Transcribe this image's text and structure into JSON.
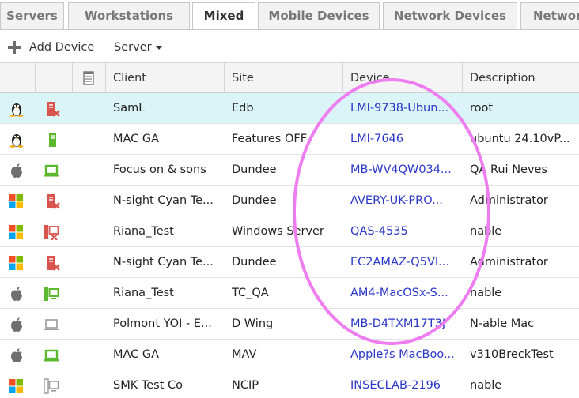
{
  "tabs": [
    {
      "label": "Servers",
      "active": false
    },
    {
      "label": "Workstations",
      "active": false
    },
    {
      "label": "Mixed",
      "active": true
    },
    {
      "label": "Mobile Devices",
      "active": false
    },
    {
      "label": "Network Devices",
      "active": false
    },
    {
      "label": "Networ",
      "active": false
    }
  ],
  "toolbar": {
    "add_device_label": "Add Device",
    "server_menu_label": "Server"
  },
  "columns": {
    "os": "",
    "status": "",
    "notes_icon": "notes-icon",
    "client": "Client",
    "site": "Site",
    "device": "Device",
    "description": "Description"
  },
  "rows": [
    {
      "os": "linux",
      "status": "server-red-x",
      "client": "SamL",
      "site": "Edb",
      "device": "LMI-9738-Ubun...",
      "description": "root",
      "selected": true
    },
    {
      "os": "linux",
      "status": "server-green",
      "client": "MAC GA",
      "site": "Features OFF",
      "device": "LMI-7646",
      "description": "ubuntu 24.10vP...",
      "selected": false
    },
    {
      "os": "apple",
      "status": "laptop-green",
      "client": "Focus on & sons",
      "site": "Dundee",
      "device": "MB-WV4QW034...",
      "description": "QA Rui Neves",
      "selected": false
    },
    {
      "os": "windows",
      "status": "server-red-x",
      "client": "N-sight Cyan Te...",
      "site": "Dundee",
      "device": "AVERY-UK-PRO...",
      "description": "Administrator",
      "selected": false
    },
    {
      "os": "windows",
      "status": "workstation-red-x",
      "client": "Riana_Test",
      "site": "Windows Server",
      "device": "QAS-4535",
      "description": "nable",
      "selected": false
    },
    {
      "os": "windows",
      "status": "server-red-x",
      "client": "N-sight Cyan Te...",
      "site": "Dundee",
      "device": "EC2AMAZ-Q5VI...",
      "description": "Administrator",
      "selected": false
    },
    {
      "os": "apple",
      "status": "workstation-green",
      "client": "Riana_Test",
      "site": "TC_QA",
      "device": "AM4-MacOSx-S...",
      "description": "nable",
      "selected": false
    },
    {
      "os": "apple",
      "status": "laptop-grey",
      "client": "Polmont YOI - E...",
      "site": "D Wing",
      "device": "MB-D4TXM17T3J",
      "description": "N-able Mac",
      "selected": false
    },
    {
      "os": "apple",
      "status": "laptop-green",
      "client": "MAC GA",
      "site": "MAV",
      "device": "Apple?s MacBoo...",
      "description": "v310BreckTest",
      "selected": false
    },
    {
      "os": "windows",
      "status": "workstation-grey",
      "client": "SMK Test Co",
      "site": "NCIP",
      "device": "INSECLAB-2196",
      "description": "nable",
      "selected": false
    }
  ],
  "colors": {
    "accent_link": "#2a37c9",
    "selected_row": "#dbf4f7",
    "status_red": "#d9534f",
    "status_green": "#5cb82e",
    "annotation": "#ee7df0"
  }
}
